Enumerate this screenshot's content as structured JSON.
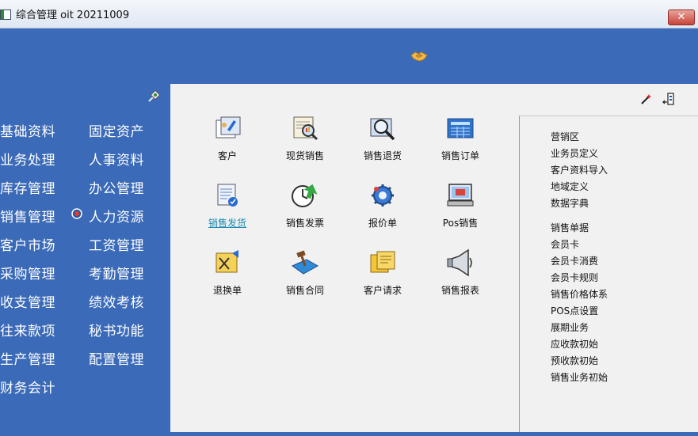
{
  "window": {
    "title": "综合管理 oit 20211009",
    "close_label": "✕"
  },
  "nav": {
    "left_col": [
      "基础资料",
      "业务处理",
      "库存管理",
      "销售管理",
      "客户市场",
      "采购管理",
      "收支管理",
      "往来款项",
      "生产管理",
      "财务会计"
    ],
    "right_col": [
      "固定资产",
      "人事资料",
      "办公管理",
      "人力资源",
      "工资管理",
      "考勤管理",
      "绩效考核",
      "秘书功能",
      "配置管理"
    ]
  },
  "tiles": [
    {
      "label": "客户",
      "icon": "customer-icon"
    },
    {
      "label": "现货销售",
      "icon": "spot-sales-icon"
    },
    {
      "label": "销售退货",
      "icon": "sales-return-icon"
    },
    {
      "label": "销售订单",
      "icon": "sales-order-icon"
    },
    {
      "label": "销售发货",
      "icon": "sales-delivery-icon"
    },
    {
      "label": "销售发票",
      "icon": "sales-invoice-icon"
    },
    {
      "label": "报价单",
      "icon": "quotation-icon"
    },
    {
      "label": "Pos销售",
      "icon": "pos-sales-icon"
    },
    {
      "label": "退换单",
      "icon": "exchange-icon"
    },
    {
      "label": "销售合同",
      "icon": "sales-contract-icon"
    },
    {
      "label": "客户请求",
      "icon": "customer-request-icon"
    },
    {
      "label": "销售报表",
      "icon": "sales-report-icon"
    }
  ],
  "side_group_1": [
    "营销区",
    "业务员定义",
    "客户资料导入",
    "地域定义",
    "数据字典"
  ],
  "side_group_2": [
    "销售单据",
    "会员卡",
    "会员卡消费",
    "会员卡规则",
    "销售价格体系",
    "POS点设置",
    "展期业务",
    "应收款初始",
    "预收款初始",
    "销售业务初始"
  ],
  "colors": {
    "nav_bg": "#3a6ab8",
    "content_bg": "#f1f1f1",
    "link": "#1d8ab0"
  }
}
